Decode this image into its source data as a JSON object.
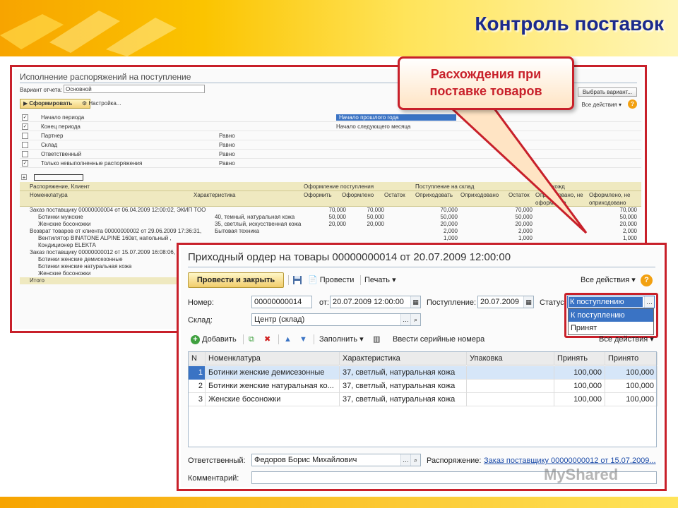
{
  "slide": {
    "title": "Контроль поставок"
  },
  "callout": {
    "line1": "Расхождения при",
    "line2": "поставке товаров"
  },
  "report": {
    "title": "Исполнение распоряжений на поступление",
    "variant_label": "Вариант отчета:",
    "variant_value": "Основной",
    "form_button": "Сформировать",
    "setup_button": "Настройка...",
    "select_variant_button": "Выбрать вариант...",
    "all_actions": "Все действия",
    "filters": [
      {
        "checked": true,
        "name": "Начало периода",
        "cond": "",
        "value": "Начало прошлого года"
      },
      {
        "checked": true,
        "name": "Конец периода",
        "cond": "",
        "value": "Начало следующего месяца"
      },
      {
        "checked": false,
        "name": "Партнер",
        "cond": "Равно",
        "value": ""
      },
      {
        "checked": false,
        "name": "Склад",
        "cond": "Равно",
        "value": ""
      },
      {
        "checked": false,
        "name": "Ответственный",
        "cond": "Равно",
        "value": ""
      },
      {
        "checked": true,
        "name": "Только невыполненные распоряжения",
        "cond": "Равно",
        "value": ""
      }
    ],
    "table": {
      "group_headers": [
        "Оформление поступления",
        "Поступление на склад",
        "Расхожд"
      ],
      "head1": "Распоряжение, Клиент",
      "head2": [
        "Номенклатура",
        "Характеристика",
        "Оформить",
        "Оформлено",
        "Остаток",
        "Оприходовать",
        "Оприходовано",
        "Остаток",
        "Оприходовано, не оформлено",
        "Оформлено, не оприходовано"
      ],
      "rows": [
        {
          "name": "Заказ поставщику 00000000004 от 06.04.2009 12:00:02, ЭКИП ТОО",
          "char": "",
          "v": [
            "70,000",
            "70,000",
            "",
            "70,000",
            "",
            "70,000",
            "",
            "70,000"
          ]
        },
        {
          "name": "Ботинки мужские",
          "char": "40, темный, натуральная кожа",
          "v": [
            "50,000",
            "50,000",
            "",
            "50,000",
            "",
            "50,000",
            "",
            "50,000"
          ]
        },
        {
          "name": "Женские босоножки",
          "char": "35, светлый, искусственная кожа",
          "v": [
            "20,000",
            "20,000",
            "",
            "20,000",
            "",
            "20,000",
            "",
            "20,000"
          ]
        },
        {
          "name": "Возврат товаров от клиента 00000000002 от 29.06.2009 17:36:31,",
          "char": "Бытовая техника",
          "v": [
            "",
            "",
            "",
            "2,000",
            "",
            "2,000",
            "",
            "2,000"
          ]
        },
        {
          "name": "Вентилятор BINATONE ALPINE 160вт, напольный ,",
          "char": "",
          "v": [
            "",
            "",
            "",
            "1,000",
            "",
            "1,000",
            "",
            "1,000"
          ]
        },
        {
          "name": "Кондиционер ELEKTA",
          "char": "",
          "v": [
            "",
            "",
            "",
            "1,000",
            "",
            "1,000",
            "",
            "1,000"
          ]
        },
        {
          "name": "Заказ поставщику 00000000012 от 15.07.2009 16:08:06,",
          "char": "",
          "v": [
            "",
            "",
            "",
            "",
            "",
            "",
            "",
            ""
          ]
        },
        {
          "name": "Ботинки женские демисезонные",
          "char": "",
          "v": [
            "",
            "",
            "",
            "",
            "",
            "",
            "",
            ""
          ]
        },
        {
          "name": "Ботинки женские натуральная кожа",
          "char": "",
          "v": [
            "",
            "",
            "",
            "",
            "",
            "",
            "",
            ""
          ]
        },
        {
          "name": "Женские босоножки",
          "char": "",
          "v": [
            "",
            "",
            "",
            "",
            "",
            "",
            "",
            ""
          ]
        }
      ],
      "total_label": "Итого"
    }
  },
  "doc": {
    "title": "Приходный ордер на товары 00000000014 от 20.07.2009 12:00:00",
    "toolbar": {
      "post_close": "Провести и закрыть",
      "post": "Провести",
      "print": "Печать",
      "all_actions": "Все действия"
    },
    "fields": {
      "number_label": "Номер:",
      "number_value": "00000000014",
      "from_label": "от:",
      "from_value": "20.07.2009 12:00:00",
      "arrival_label": "Поступление:",
      "arrival_value": "20.07.2009",
      "status_label": "Статус:",
      "status_value": "К поступлению",
      "warehouse_label": "Склад:",
      "warehouse_value": "Центр (склад)",
      "responsible_label": "Ответственный:",
      "responsible_value": "Федоров Борис Михайлович",
      "order_label": "Распоряжение:",
      "order_value": "Заказ поставщику 00000000012 от 15.07.2009...",
      "comment_label": "Комментарий:",
      "comment_value": ""
    },
    "status_options": [
      "К поступлению",
      "Принят"
    ],
    "table_toolbar": {
      "add": "Добавить",
      "fill": "Заполнить",
      "serials": "Ввести серийные номера",
      "all_actions": "Все действия"
    },
    "columns": [
      "N",
      "Номенклатура",
      "Характеристика",
      "Упаковка",
      "Принять",
      "Принято"
    ],
    "rows": [
      {
        "n": "1",
        "item": "Ботинки женские демисезонные",
        "char": "37, светлый, натуральная кожа",
        "pack": "",
        "accept": "100,000",
        "accepted": "100,000"
      },
      {
        "n": "2",
        "item": "Ботинки женские натуральная ко...",
        "char": "37, светлый, натуральная кожа",
        "pack": "",
        "accept": "100,000",
        "accepted": "100,000"
      },
      {
        "n": "3",
        "item": "Женские босоножки",
        "char": "37, светлый, натуральная кожа",
        "pack": "",
        "accept": "100,000",
        "accepted": "100,000"
      }
    ]
  },
  "watermark": "MyShared"
}
